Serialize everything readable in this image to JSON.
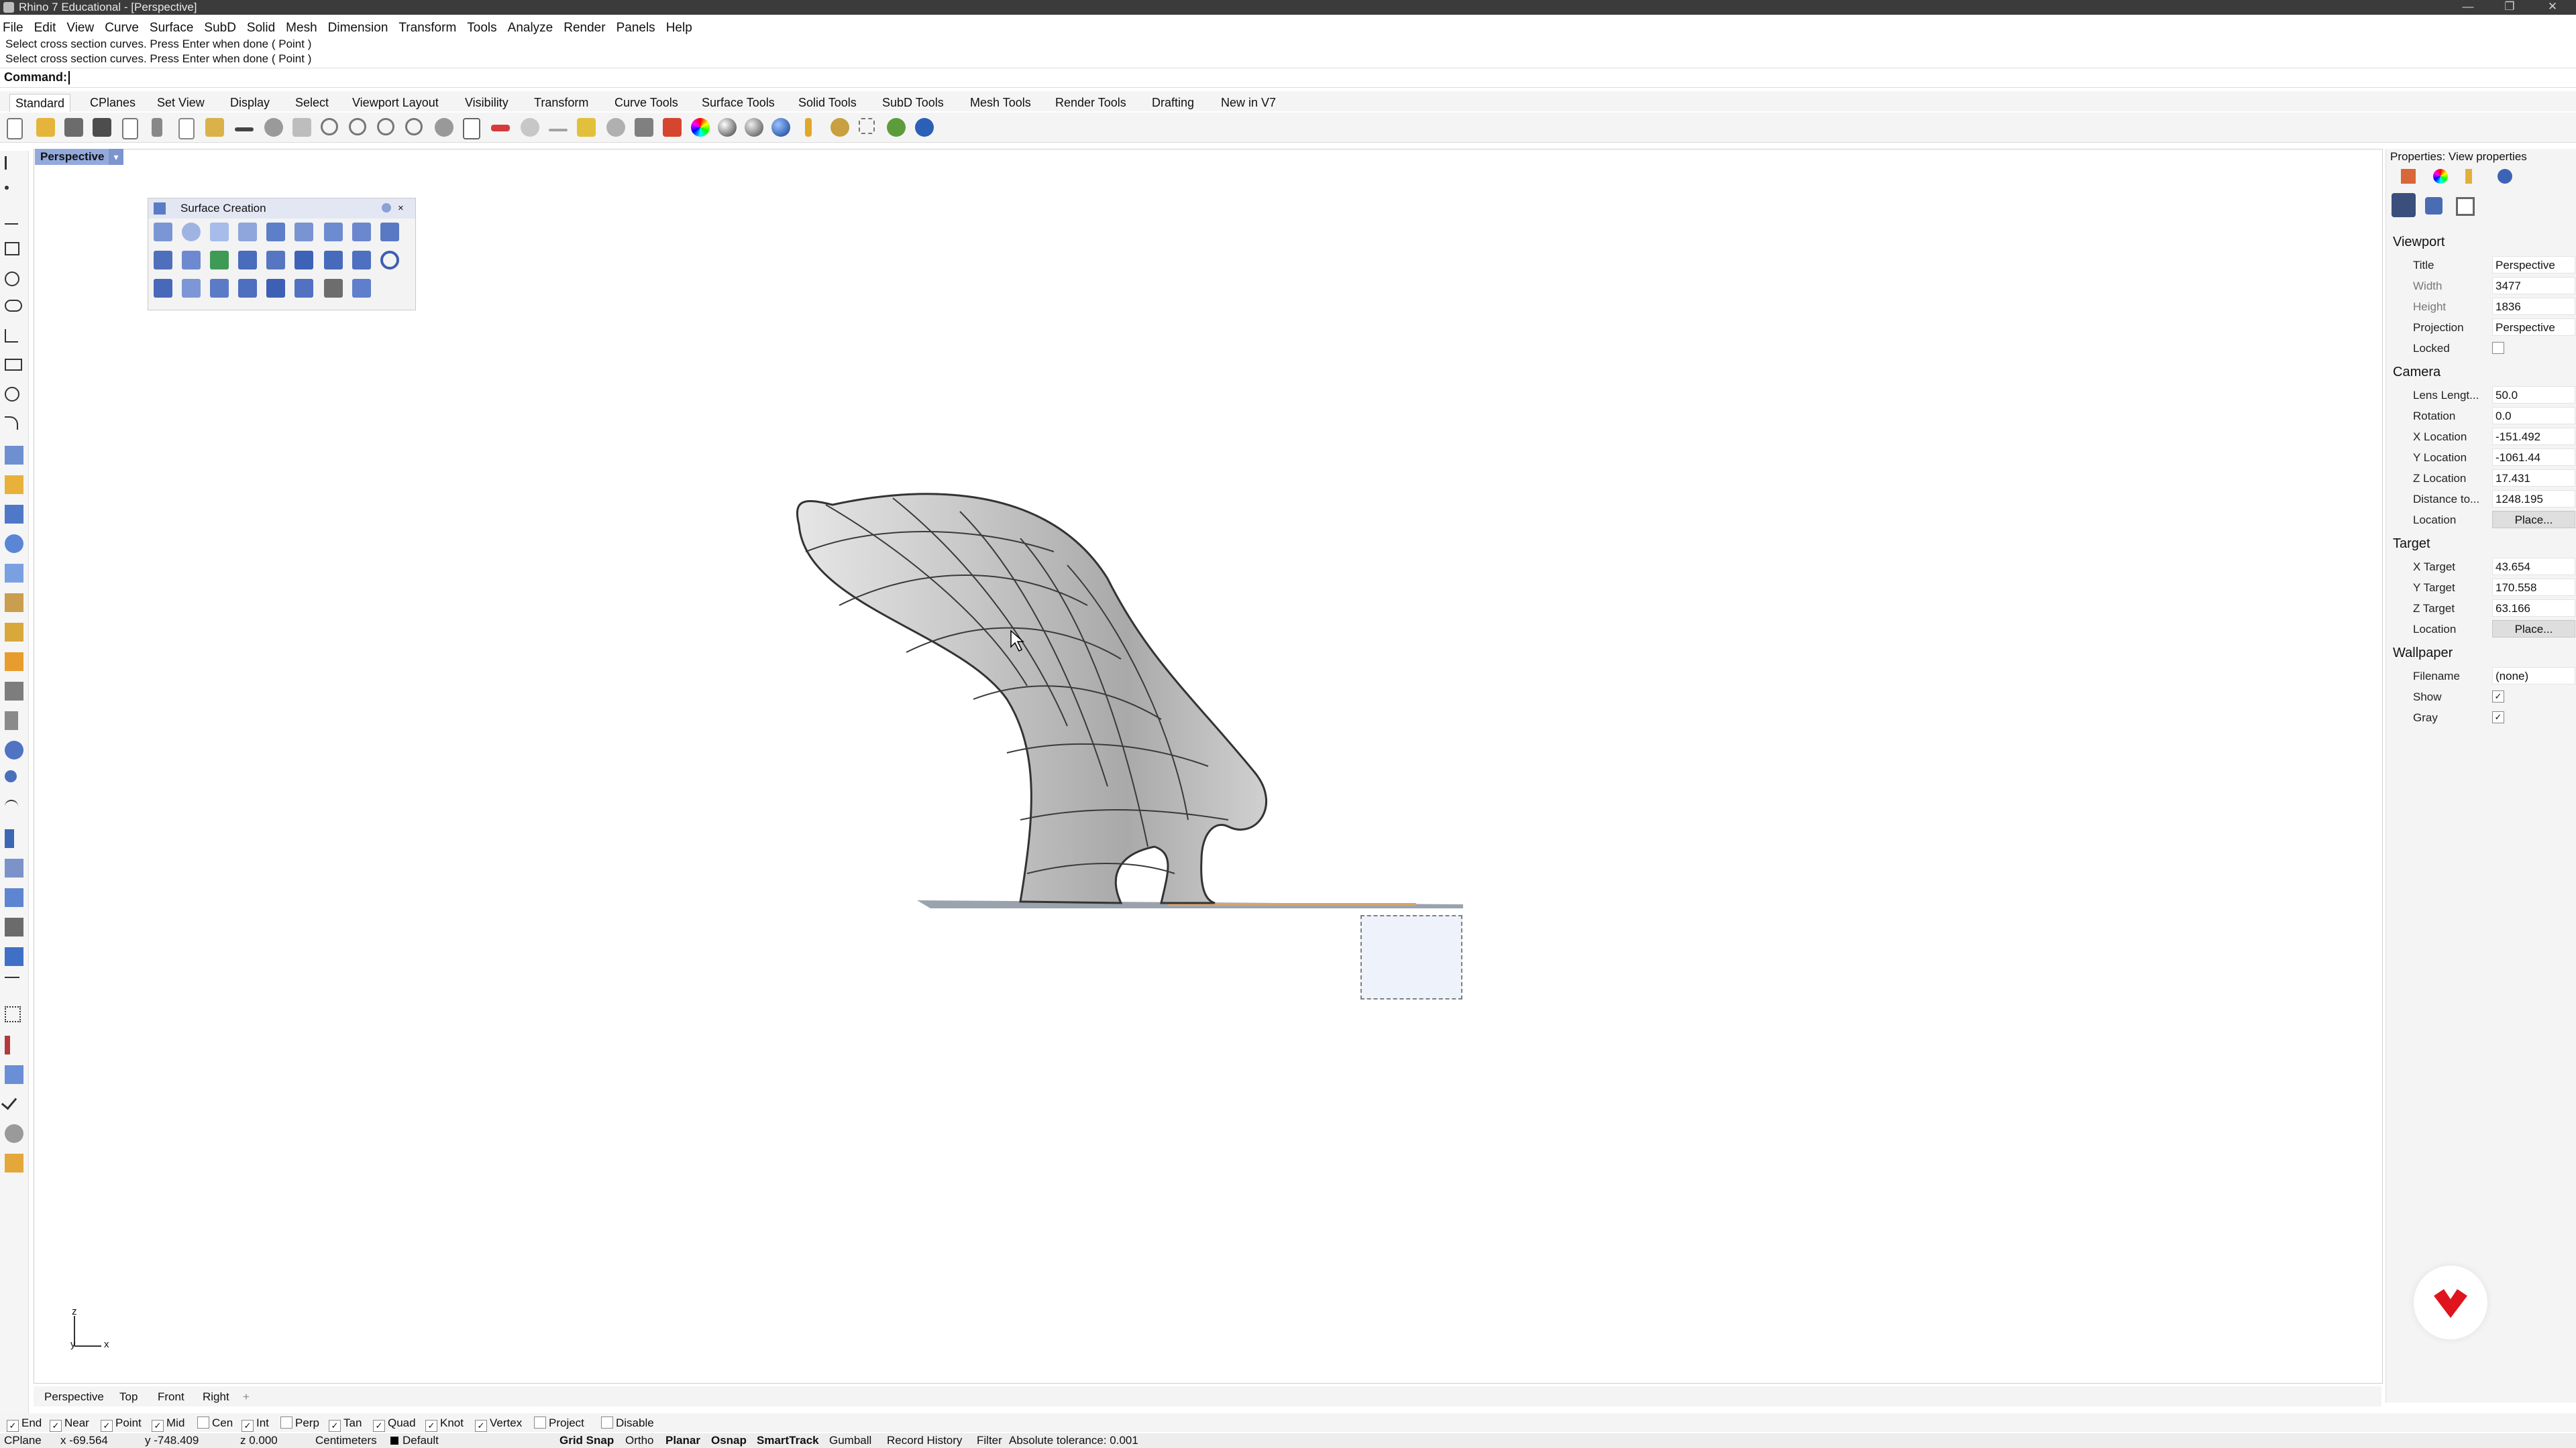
{
  "window": {
    "title": "Rhino 7 Educational - [Perspective]",
    "minimize": "—",
    "restore": "❐",
    "close": "✕"
  },
  "menu": [
    "File",
    "Edit",
    "View",
    "Curve",
    "Surface",
    "SubD",
    "Solid",
    "Mesh",
    "Dimension",
    "Transform",
    "Tools",
    "Analyze",
    "Render",
    "Panels",
    "Help"
  ],
  "command": {
    "history_1": "Select cross section curves. Press Enter when done ( Point )",
    "history_2": "Select cross section curves. Press Enter when done ( Point )",
    "prompt": "Command:"
  },
  "tabs": [
    "Standard",
    "CPlanes",
    "Set View",
    "Display",
    "Select",
    "Viewport Layout",
    "Visibility",
    "Transform",
    "Curve Tools",
    "Surface Tools",
    "Solid Tools",
    "SubD Tools",
    "Mesh Tools",
    "Render Tools",
    "Drafting",
    "New in V7"
  ],
  "viewport": {
    "name": "Perspective",
    "axis_z": "z",
    "axis_x": "x",
    "axis_y": "y"
  },
  "surface_panel": {
    "title": "Surface Creation"
  },
  "viewport_tabs": [
    "Perspective",
    "Top",
    "Front",
    "Right"
  ],
  "viewport_tabs_add": "+",
  "osnaps": [
    {
      "label": "End",
      "checked": true
    },
    {
      "label": "Near",
      "checked": true
    },
    {
      "label": "Point",
      "checked": true
    },
    {
      "label": "Mid",
      "checked": true
    },
    {
      "label": "Cen",
      "checked": false
    },
    {
      "label": "Int",
      "checked": true
    },
    {
      "label": "Perp",
      "checked": false
    },
    {
      "label": "Tan",
      "checked": true
    },
    {
      "label": "Quad",
      "checked": true
    },
    {
      "label": "Knot",
      "checked": true
    },
    {
      "label": "Vertex",
      "checked": true
    },
    {
      "label": "Project",
      "checked": false
    },
    {
      "label": "Disable",
      "checked": false
    }
  ],
  "status": {
    "cplane": "CPlane",
    "x": "x -69.564",
    "y": "y -748.409",
    "z": "z 0.000",
    "units": "Centimeters",
    "layer": "Default",
    "grid_snap": "Grid Snap",
    "ortho": "Ortho",
    "planar": "Planar",
    "osnap": "Osnap",
    "smarttrack": "SmartTrack",
    "gumball": "Gumball",
    "record_history": "Record History",
    "filter": "Filter",
    "tolerance": "Absolute tolerance: 0.001"
  },
  "properties": {
    "header": "Properties: View properties",
    "viewport_section": "Viewport",
    "title_label": "Title",
    "title_value": "Perspective",
    "width_label": "Width",
    "width_value": "3477",
    "height_label": "Height",
    "height_value": "1836",
    "projection_label": "Projection",
    "projection_value": "Perspective",
    "locked_label": "Locked",
    "camera_section": "Camera",
    "lens_label": "Lens Lengt...",
    "lens_value": "50.0",
    "rotation_label": "Rotation",
    "rotation_value": "0.0",
    "xloc_label": "X Location",
    "xloc_value": "-151.492",
    "yloc_label": "Y Location",
    "yloc_value": "-1061.44",
    "zloc_label": "Z Location",
    "zloc_value": "17.431",
    "dist_label": "Distance to...",
    "dist_value": "1248.195",
    "location_label": "Location",
    "location_button": "Place...",
    "target_section": "Target",
    "xt_label": "X Target",
    "xt_value": "43.654",
    "yt_label": "Y Target",
    "yt_value": "170.558",
    "zt_label": "Z Target",
    "zt_value": "63.166",
    "tloc_label": "Location",
    "tloc_button": "Place...",
    "wallpaper_section": "Wallpaper",
    "file_label": "Filename",
    "file_value": "(none)",
    "show_label": "Show",
    "gray_label": "Gray"
  },
  "colors": {
    "viewport_tab": "#93a9dc",
    "accent_red": "#e0141e",
    "surface_gray": "#b8b8b8"
  }
}
